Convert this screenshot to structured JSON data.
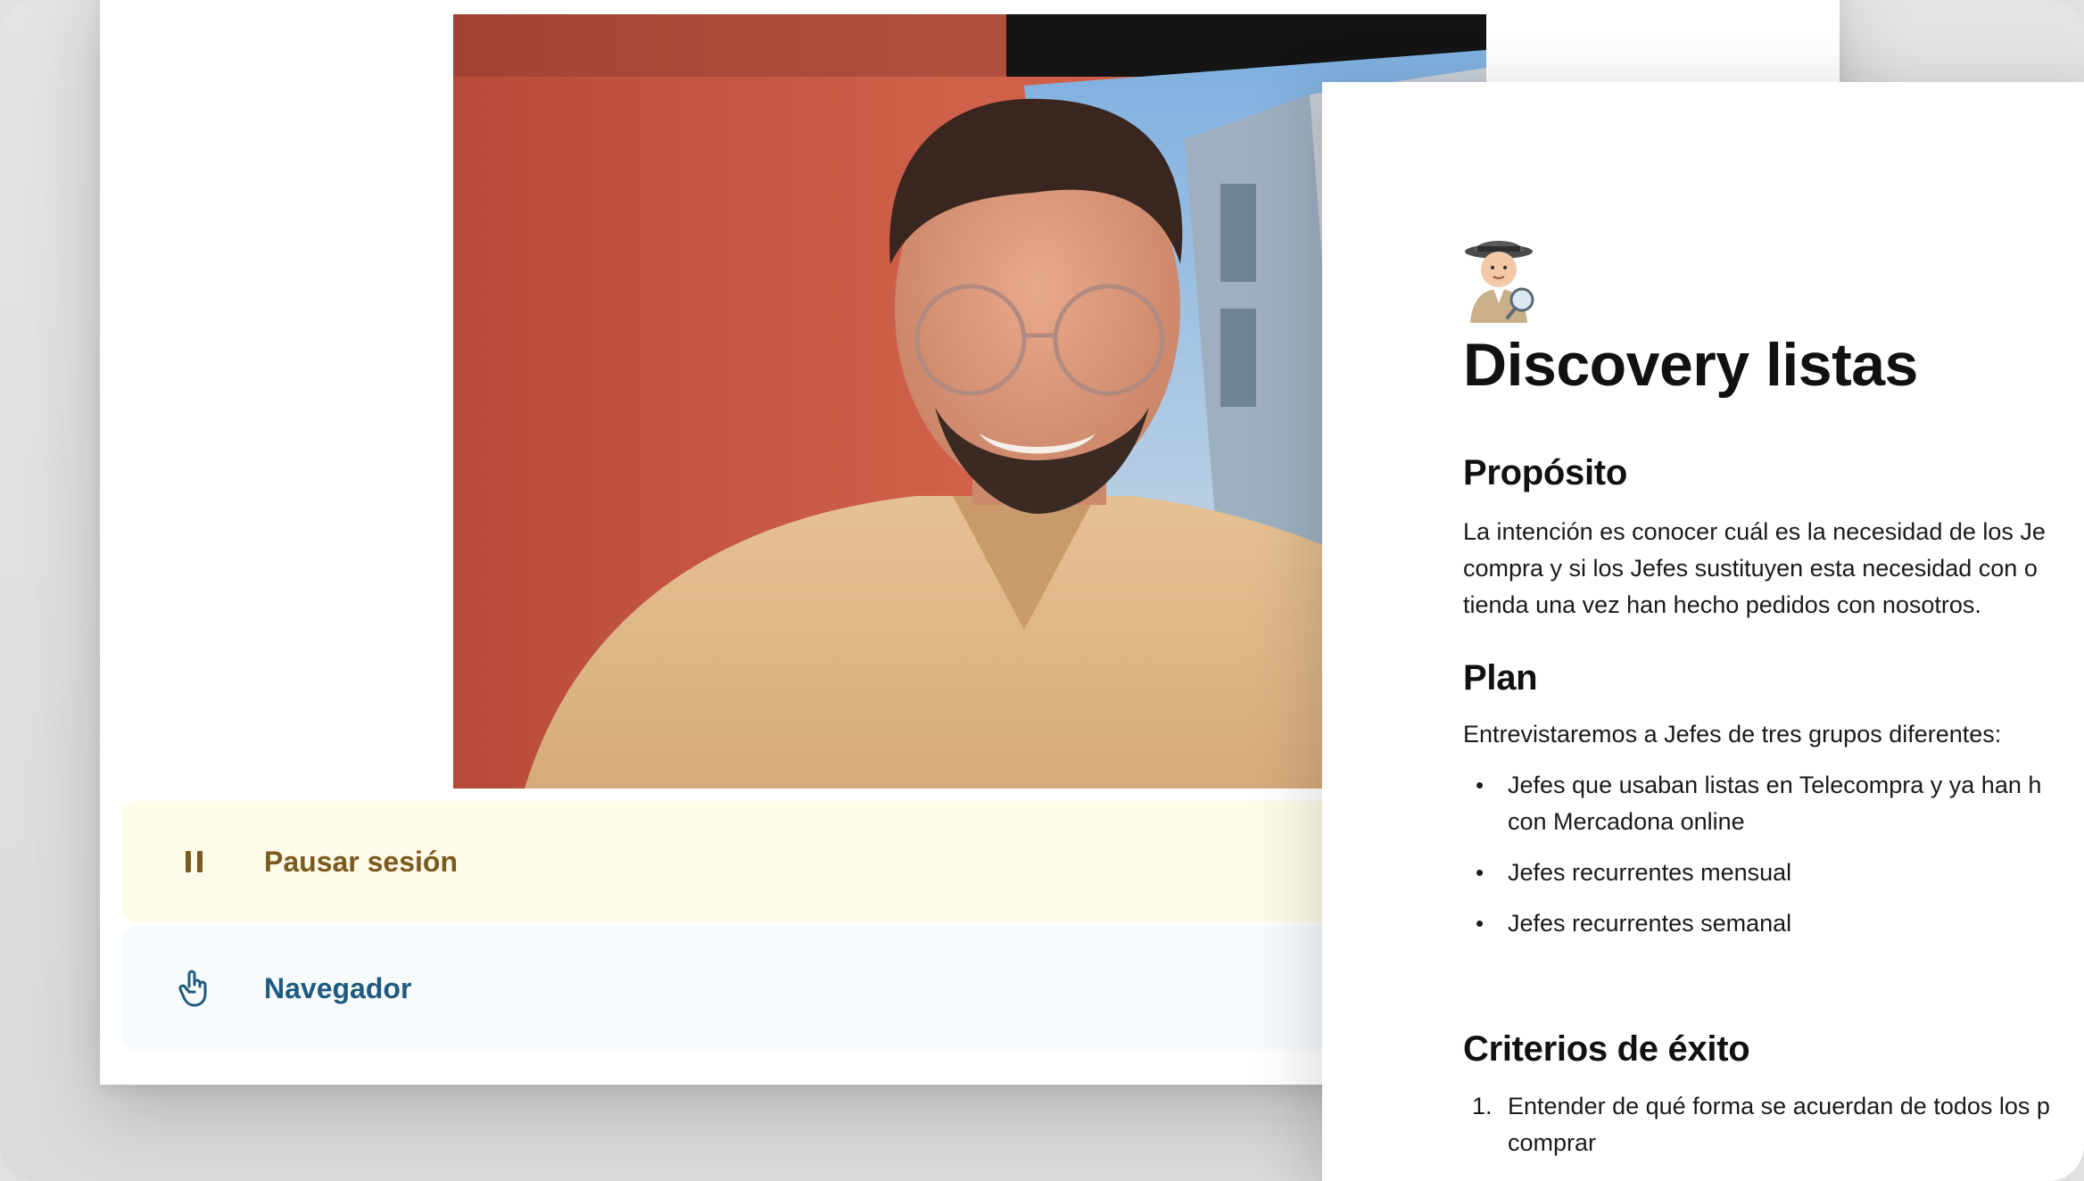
{
  "call": {
    "pause_label": "Pausar sesión",
    "nav_label": "Navegador",
    "pause_icon": "pause-icon",
    "nav_icon": "pointing-hand-icon"
  },
  "doc": {
    "emoji_icon": "detective-icon",
    "title": "Discovery listas",
    "purpose_heading": "Propósito",
    "purpose_lines": [
      "La intención es conocer cuál es la necesidad de los Je",
      "compra y si los Jefes sustituyen esta necesidad con o",
      "tienda una vez han hecho pedidos con nosotros."
    ],
    "plan_heading": "Plan",
    "plan_intro": "Entrevistaremos a Jefes de tres grupos diferentes:",
    "plan_items": [
      {
        "line1": "Jefes que usaban listas en Telecompra y ya han h",
        "line2": "con Mercadona online"
      },
      {
        "line1": "Jefes recurrentes mensual",
        "line2": ""
      },
      {
        "line1": "Jefes recurrentes semanal",
        "line2": ""
      }
    ],
    "criteria_heading": "Criterios de éxito",
    "criteria_items": [
      {
        "num": "1.",
        "line1": "Entender de qué forma se acuerdan de todos los p",
        "line2": "comprar"
      }
    ]
  },
  "colors": {
    "background": "#dfe1e1",
    "video_wall": "#c85a45",
    "pause_bg": "#fffbe9",
    "pause_text": "#7a5a1f",
    "nav_text": "#205a7e"
  }
}
